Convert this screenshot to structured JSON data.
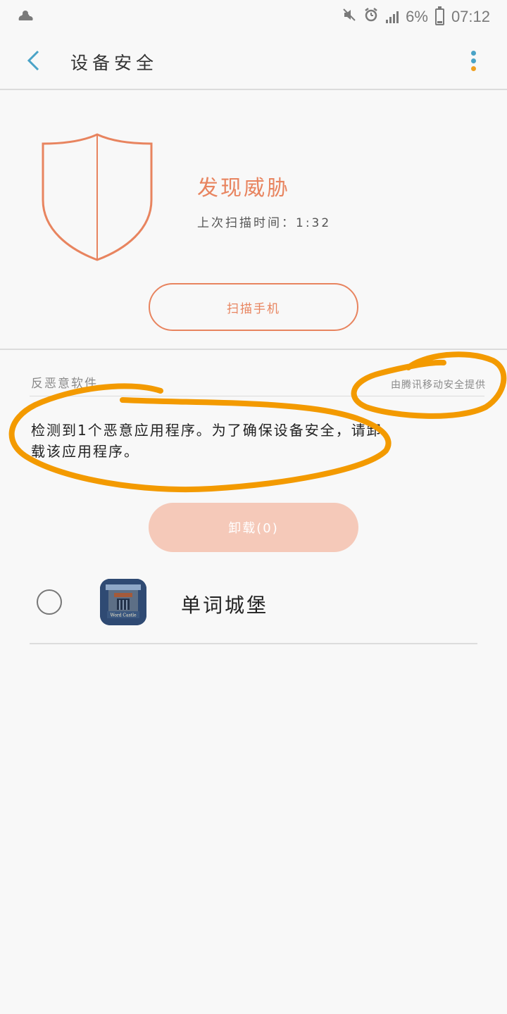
{
  "status_bar": {
    "battery_percent": "6%",
    "time": "07:12",
    "icons": [
      "weather-icon",
      "mute-icon",
      "alarm-icon",
      "signal-icon",
      "battery-icon"
    ]
  },
  "header": {
    "title": "设备安全"
  },
  "summary": {
    "status_title": "发现威胁",
    "last_scan": "上次扫描时间：1:32",
    "scan_button_label": "扫描手机"
  },
  "malware_section": {
    "label": "反恶意软件",
    "provider": "由腾讯移动安全提供",
    "message": "检测到1个恶意应用程序。为了确保设备安全，请卸载该应用程序。",
    "uninstall_button_label": "卸载(0)",
    "apps": [
      {
        "name": "单词城堡",
        "icon_text": "Word Castle",
        "selected": false
      }
    ]
  },
  "colors": {
    "accent": "#e8845f",
    "accent_light": "#f5c9b9",
    "back_arrow": "#4aa3c7",
    "menu_dot_blue": "#4aa3c7",
    "menu_dot_orange": "#f0a020",
    "annotation": "#f39a00"
  }
}
